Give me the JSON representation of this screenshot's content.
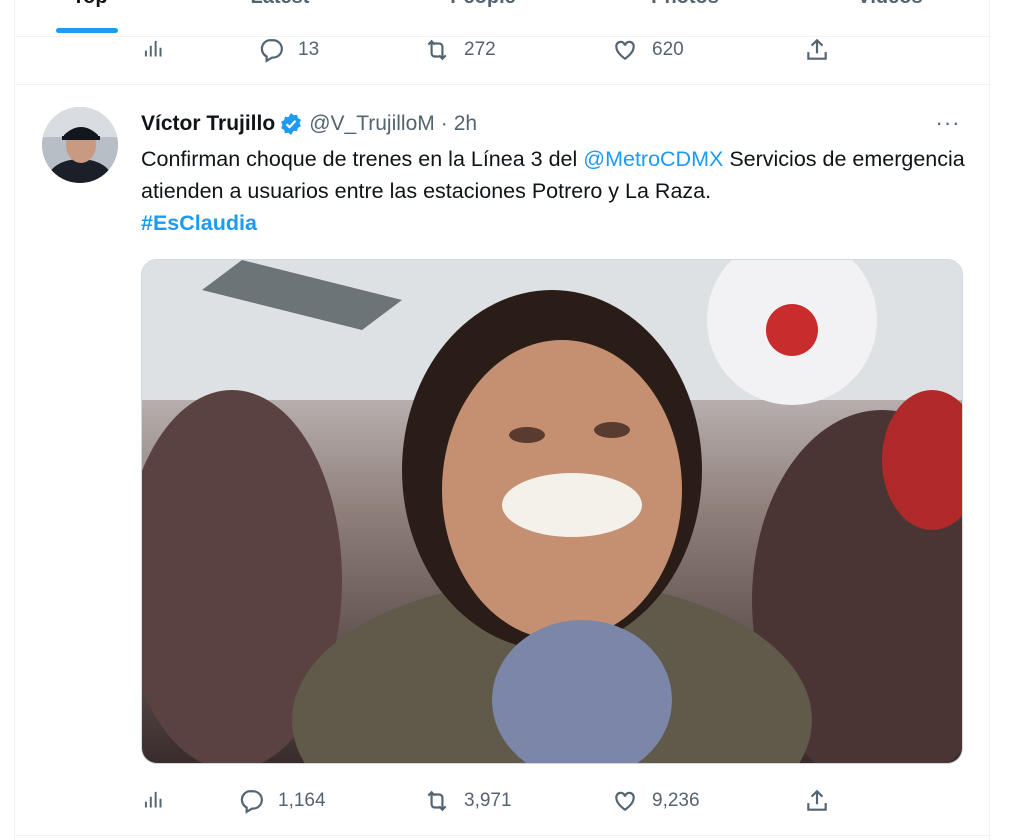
{
  "tabs": [
    {
      "label": "Top"
    },
    {
      "label": "Latest"
    },
    {
      "label": "People"
    },
    {
      "label": "Photos"
    },
    {
      "label": "Videos"
    }
  ],
  "prev_tweet": {
    "replies": "13",
    "retweets": "272",
    "likes": "620"
  },
  "tweet": {
    "name": "Víctor Trujillo",
    "handle": "@V_TrujilloM",
    "separator": "·",
    "time": "2h",
    "more": "···",
    "text_before": "Confirman choque de trenes en la Línea 3 del ",
    "mention": "@MetroCDMX",
    "text_after": " Servicios de emergencia atienden a usuarios entre las estaciones Potrero y La Raza.",
    "hashtag": "#EsClaudia",
    "replies": "1,164",
    "retweets": "3,971",
    "likes": "9,236"
  },
  "colors": {
    "accent": "#1d9bf0",
    "text": "#0f1419",
    "secondary": "#536471"
  },
  "icons": [
    "analytics-icon",
    "reply-icon",
    "retweet-icon",
    "like-icon",
    "share-icon",
    "verified-badge-icon",
    "more-icon"
  ]
}
